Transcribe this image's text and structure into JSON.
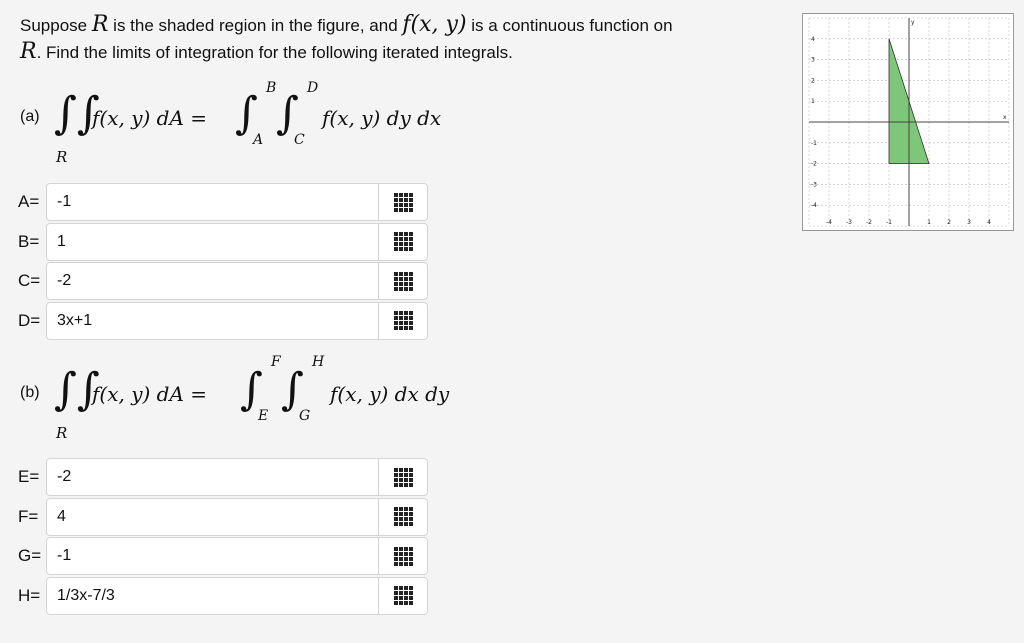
{
  "problem": {
    "text1": "Suppose",
    "R1": "R",
    "text2": "is the shaded region in the figure, and",
    "fxy": "f(x, y)",
    "text3": "is a continuous function on",
    "R2": "R",
    "text4": ". Find the limits of integration for the following iterated integrals."
  },
  "part_a": {
    "label": "(a)",
    "integral_sign": "∫∫",
    "region": "R",
    "lhs": "f(x, y) dA =",
    "outer_lower": "A",
    "outer_upper": "B",
    "inner_lower": "C",
    "inner_upper": "D",
    "integrand": "f(x, y) dy dx"
  },
  "part_b": {
    "label": "(b)",
    "integral_sign": "∫∫",
    "region": "R",
    "lhs": "f(x, y) dA =",
    "outer_lower": "E",
    "outer_upper": "F",
    "inner_lower": "G",
    "inner_upper": "H",
    "integrand": "f(x, y) dx dy"
  },
  "fields_a": [
    {
      "label": "A=",
      "value": "-1"
    },
    {
      "label": "B=",
      "value": "1"
    },
    {
      "label": "C=",
      "value": "-2"
    },
    {
      "label": "D=",
      "value": "3x+1"
    }
  ],
  "fields_b": [
    {
      "label": "E=",
      "value": "-2"
    },
    {
      "label": "F=",
      "value": "4"
    },
    {
      "label": "G=",
      "value": "-1"
    },
    {
      "label": "H=",
      "value": "1/3x-7/3"
    }
  ],
  "figure": {
    "x_ticks": [
      "-4",
      "-3",
      "-2",
      "-1",
      "1",
      "2",
      "3",
      "4"
    ],
    "y_ticks": [
      "4",
      "3",
      "2",
      "1",
      "-1",
      "-2",
      "-3",
      "-4"
    ],
    "x_axis_label": "x",
    "y_axis_label": "y",
    "shaded_color": "#7ec77a",
    "shaded_vertices_data": [
      [
        -1,
        4
      ],
      [
        -1,
        -2
      ],
      [
        1,
        -2
      ]
    ]
  }
}
